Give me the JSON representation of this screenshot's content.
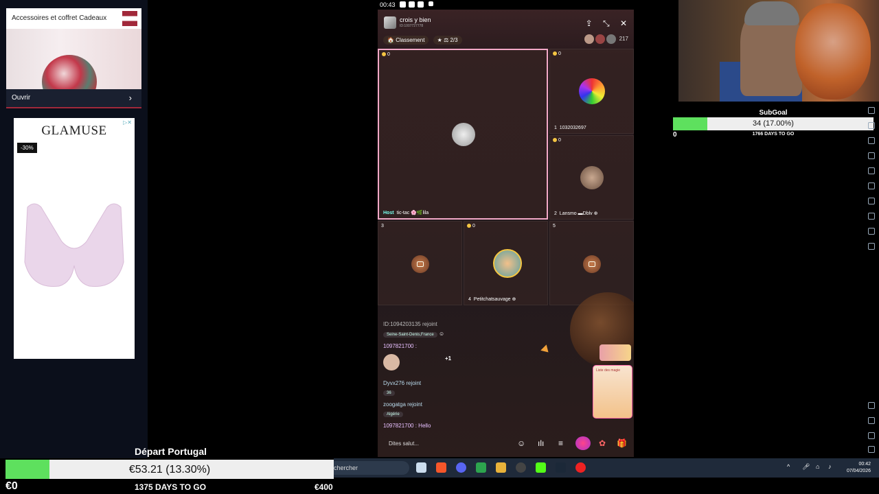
{
  "ads": {
    "ad1": {
      "title": "Accessoires et coffret Cadeaux",
      "cta": "Ouvrir"
    },
    "ad2": {
      "brand": "GLAMUSE",
      "discount": "-30%"
    }
  },
  "phone_status": {
    "time": "00:43"
  },
  "room": {
    "title": "crois y bien",
    "id": "ID:1007727778",
    "ranking_label": "Classement",
    "counter": "2/3",
    "viewer_count": "217",
    "seats": [
      {
        "coins": "0",
        "badge": "Host",
        "name": "tic-tac 🌸🌿lila"
      },
      {
        "coins": "0",
        "num": "1",
        "name": "1032032697"
      },
      {
        "coins": "0",
        "num": "2",
        "name": "Lansmo ▬Dblv"
      },
      {
        "num": "3"
      },
      {
        "coins": "0",
        "num": "4",
        "name": "Petitchatsauvage"
      },
      {
        "num": "5"
      }
    ],
    "chat": [
      {
        "text": "ID:1094203135 rejoint"
      },
      {
        "tag": "Seine-Saint-Denis,France"
      },
      {
        "text": "1097821700 :"
      },
      {
        "text": "+1"
      },
      {
        "text": "Dyvx276 rejoint"
      },
      {
        "tag": "36"
      },
      {
        "text": "zoogatga rejoint"
      },
      {
        "tag": "Algérie"
      },
      {
        "text": "1097821700 : Hello"
      }
    ],
    "gift_card_label": "Liste des magie",
    "input_placeholder": "Dites salut..."
  },
  "subgoal": {
    "title": "SubGoal",
    "progress_text": "34 (17.00%)",
    "progress": 0.17,
    "start": "0",
    "days": "1766 DAYS TO GO"
  },
  "donation_goal": {
    "title": "Départ Portugal",
    "progress_text": "€53.21 (13.30%)",
    "progress": 0.133,
    "start": "€0",
    "days": "1375 DAYS TO GO",
    "target": "€400"
  },
  "taskbar": {
    "search_placeholder": "chercher",
    "clock_time": "00:42",
    "clock_date": "07/04/2026"
  }
}
